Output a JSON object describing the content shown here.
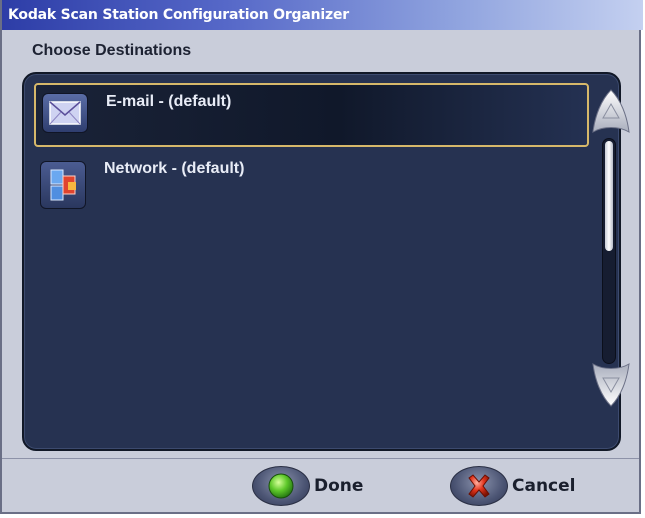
{
  "window": {
    "title": "Kodak Scan Station Configuration Organizer"
  },
  "section": {
    "title": "Choose Destinations"
  },
  "destinations": [
    {
      "label": "E-mail - (default)",
      "icon": "envelope-icon",
      "selected": true
    },
    {
      "label": "Network - (default)",
      "icon": "network-icon",
      "selected": false
    }
  ],
  "footer": {
    "done_label": "Done",
    "cancel_label": "Cancel"
  },
  "colors": {
    "panel": "#263251",
    "selection_border": "#d6b86a",
    "titlebar_start": "#2d3da7"
  }
}
